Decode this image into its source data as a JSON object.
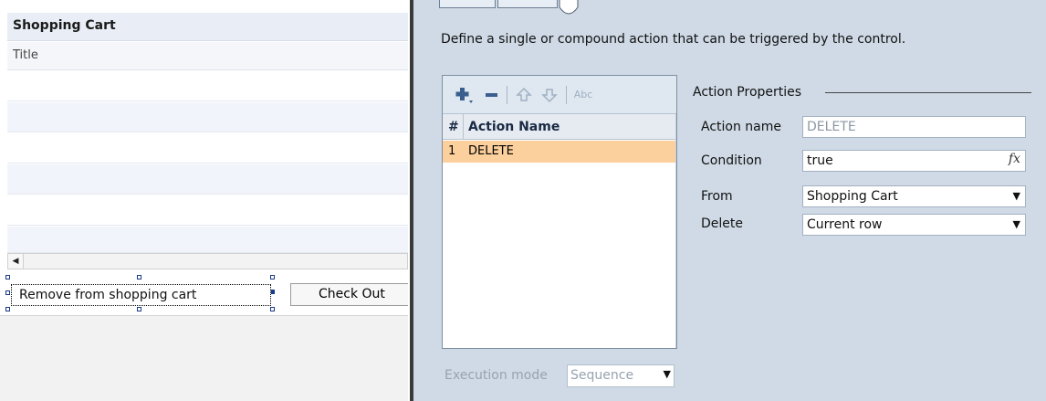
{
  "canvas": {
    "cart_title": "Shopping Cart",
    "column_title": "Title",
    "remove_button": "Remove from shopping cart",
    "checkout_button": "Check Out"
  },
  "panel": {
    "description": "Define a single or compound action that can be triggered by the control.",
    "list": {
      "toolbar": {
        "add_icon": "add-icon",
        "remove_icon": "remove-icon",
        "move_up_icon": "arrow-up-icon",
        "move_down_icon": "arrow-down-icon",
        "rename_icon": "rename-icon",
        "rename_text": "Abc"
      },
      "columns": [
        "#",
        "Action Name"
      ],
      "rows": [
        {
          "num": "1",
          "name": "DELETE",
          "selected": true
        }
      ]
    },
    "execution_mode": {
      "label": "Execution mode",
      "value": "Sequence"
    },
    "properties": {
      "title": "Action Properties",
      "action_name_label": "Action name",
      "action_name_value": "DELETE",
      "condition_label": "Condition",
      "condition_value": "true",
      "condition_button": "fx",
      "from_label": "From",
      "from_value": "Shopping Cart",
      "delete_label": "Delete",
      "delete_value": "Current row"
    }
  },
  "colors": {
    "panel_bg": "#cfdae6",
    "selected_row": "#fcd09c",
    "header_bg": "#e9edf5"
  }
}
